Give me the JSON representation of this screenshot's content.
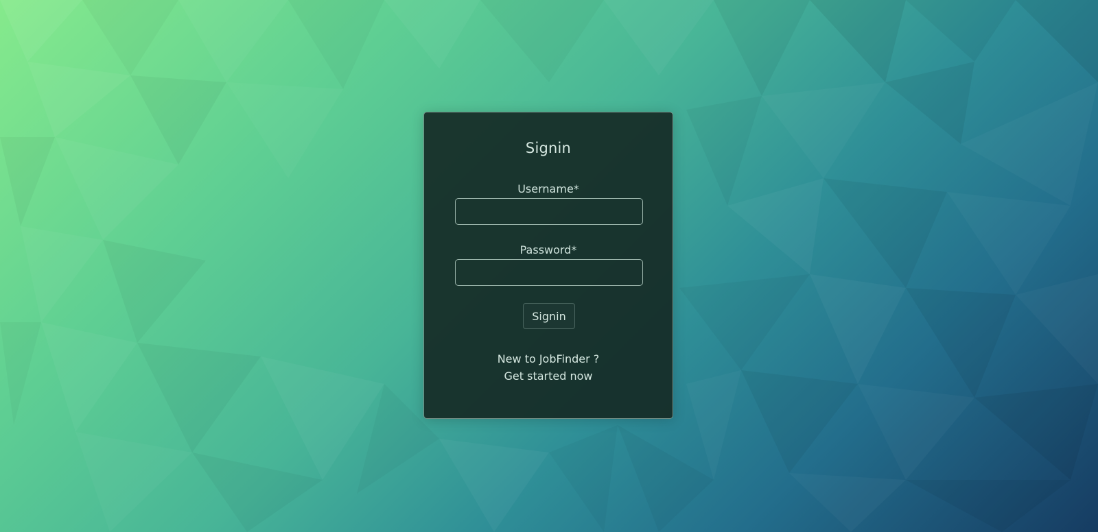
{
  "colors": {
    "background_top_left": "#86ea8c",
    "background_bottom_right": "#163c62",
    "card_background": "#162b26",
    "text": "#d6e8e1"
  },
  "form": {
    "title": "Signin",
    "username_label": "Username*",
    "username_value": "",
    "password_label": "Password*",
    "password_value": "",
    "submit_label": "Signin"
  },
  "footer": {
    "prompt": "New to JobFinder ?",
    "link": "Get started now"
  }
}
